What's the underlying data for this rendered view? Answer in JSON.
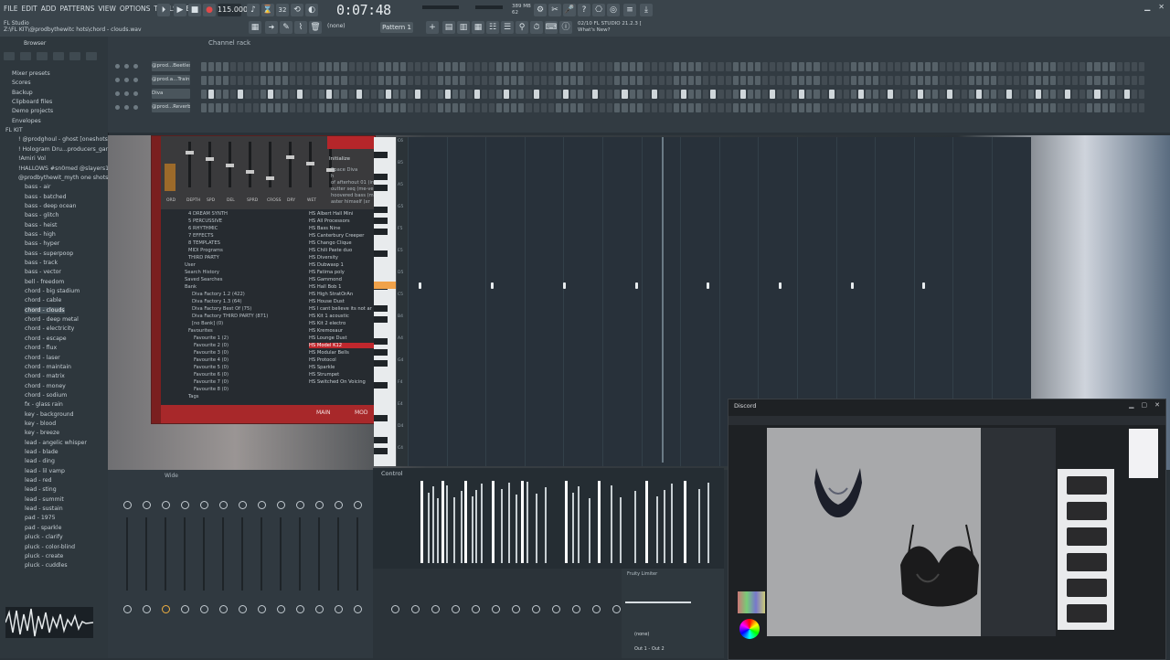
{
  "menu": [
    "FILE",
    "EDIT",
    "ADD",
    "PATTERNS",
    "VIEW",
    "OPTIONS",
    "TOOLS",
    "HELP"
  ],
  "file_info": {
    "line1": "FL Studio",
    "line2": "Z:\\FL KIT\\@prodbythewitc hots\\chord - clouds.wav"
  },
  "transport": {
    "tempo": "115.000",
    "time": "0:07:48",
    "pattern": "Pattern 1",
    "snap": "(none)"
  },
  "cpu": {
    "line1": "389 MB",
    "line2": "62"
  },
  "news": {
    "line1": "02/10  FL STUDIO 21.2.3 [",
    "line2": "What's New?"
  },
  "browser": {
    "title": "Browser",
    "items": [
      {
        "label": "Mixer presets",
        "indent": 1
      },
      {
        "label": "Scores",
        "indent": 1
      },
      {
        "label": "Backup",
        "indent": 1
      },
      {
        "label": "Clipboard files",
        "indent": 1
      },
      {
        "label": "Demo projects",
        "indent": 1
      },
      {
        "label": "Envelopes",
        "indent": 1
      },
      {
        "label": "FL KIT",
        "indent": 0
      },
      {
        "label": "! @prodghoul - ghost [oneshots]",
        "indent": 2
      },
      {
        "label": "! Hologram Dru...producers_gang]",
        "indent": 2
      },
      {
        "label": "!Amiri Vol",
        "indent": 2
      },
      {
        "label": "!HALLOWS #sn0med @slayers1de",
        "indent": 2
      },
      {
        "label": "@prodbythewit_myth one shots",
        "indent": 2
      },
      {
        "label": "bass - air",
        "indent": 3
      },
      {
        "label": "bass - batched",
        "indent": 3
      },
      {
        "label": "bass - deep ocean",
        "indent": 3
      },
      {
        "label": "bass - glitch",
        "indent": 3
      },
      {
        "label": "bass - heist",
        "indent": 3
      },
      {
        "label": "bass - high",
        "indent": 3
      },
      {
        "label": "bass - hyper",
        "indent": 3
      },
      {
        "label": "bass - superpoop",
        "indent": 3
      },
      {
        "label": "bass - track",
        "indent": 3
      },
      {
        "label": "bass - vector",
        "indent": 3
      },
      {
        "label": "bell - freedom",
        "indent": 3
      },
      {
        "label": "chord - big stadium",
        "indent": 3
      },
      {
        "label": "chord - cable",
        "indent": 3
      },
      {
        "label": "chord - clouds",
        "indent": 3
      },
      {
        "label": "chord - deep metal",
        "indent": 3
      },
      {
        "label": "chord - electricity",
        "indent": 3
      },
      {
        "label": "chord - escape",
        "indent": 3
      },
      {
        "label": "chord - flux",
        "indent": 3
      },
      {
        "label": "chord - laser",
        "indent": 3
      },
      {
        "label": "chord - maintain",
        "indent": 3
      },
      {
        "label": "chord - matrix",
        "indent": 3
      },
      {
        "label": "chord - money",
        "indent": 3
      },
      {
        "label": "chord - sodium",
        "indent": 3
      },
      {
        "label": "fx - glass rain",
        "indent": 3
      },
      {
        "label": "key - background",
        "indent": 3
      },
      {
        "label": "key - blood",
        "indent": 3
      },
      {
        "label": "key - breeze",
        "indent": 3
      },
      {
        "label": "lead - angelic whisper",
        "indent": 3
      },
      {
        "label": "lead - blade",
        "indent": 3
      },
      {
        "label": "lead - ding",
        "indent": 3
      },
      {
        "label": "lead - lil vamp",
        "indent": 3
      },
      {
        "label": "lead - red",
        "indent": 3
      },
      {
        "label": "lead - sting",
        "indent": 3
      },
      {
        "label": "lead - summit",
        "indent": 3
      },
      {
        "label": "lead - sustain",
        "indent": 3
      },
      {
        "label": "pad - 1975",
        "indent": 3
      },
      {
        "label": "pad - sparkle",
        "indent": 3
      },
      {
        "label": "pluck - clarify",
        "indent": 3
      },
      {
        "label": "pluck - color-blind",
        "indent": 3
      },
      {
        "label": "pluck - create",
        "indent": 3
      },
      {
        "label": "pluck - cuddles",
        "indent": 3
      }
    ]
  },
  "channel_rack": {
    "title": "Channel rack",
    "channels": [
      {
        "name": "@prod...Beetles"
      },
      {
        "name": "@prod.a...Train"
      },
      {
        "name": "Diva"
      },
      {
        "name": "@prod...Reverb"
      }
    ]
  },
  "plugin": {
    "knob_labels": [
      "ORD",
      "DEPTH",
      "SPD",
      "DEL",
      "SPRD",
      "CROSS",
      "DRY",
      "WET"
    ],
    "preset_header": "Initialize",
    "preset_lines": [
      "Space Diva",
      "h",
      "of afterhout 01 (in",
      "outter seq (me-ve",
      "hoovered bass (m",
      "aster himself (xr"
    ],
    "tree": [
      "4 DREAM SYNTH",
      "5 PERCUSSIVE",
      "6 RHYTHMIC",
      "7 EFFECTS",
      "8 TEMPLATES",
      "MIDI Programs",
      "THIRD PARTY",
      "User",
      "Search History",
      "Saved Searches",
      "Bank",
      "Diva Factory 1.2 (422)",
      "Diva Factory 1.3 (64)",
      "Diva Factory Best Of (75)",
      "Diva Factory THIRD PARTY (871)",
      "[no Bank] (0)",
      "Favourites",
      "Favourite 1 (2)",
      "Favourite 2 (0)",
      "Favourite 3 (0)",
      "Favourite 4 (0)",
      "Favourite 5 (0)",
      "Favourite 6 (0)",
      "Favourite 7 (0)",
      "Favourite 8 (0)",
      "Tags"
    ],
    "presets": [
      "HS Albert Hall Mini",
      "HS All Processors",
      "HS Bass Nine",
      "HS Canterbury Creeper",
      "HS Chango Clique",
      "HS Chili Paste duo",
      "HS Diversity",
      "HS Dubwasp 1",
      "HS Fatima poly",
      "HS Gammond",
      "HS Hall Bob 1",
      "HS High StratOrAn",
      "HS House Dust",
      "HS I cant believe its not ar",
      "HS Kit 1 acoustic",
      "HS Kit 2 electro",
      "HS Kremosaur",
      "HS Lounge Dust",
      "HS Model K12",
      "HS Modular Bells",
      "HS Protocol",
      "HS Sparkle",
      "HS Strumpet",
      "HS Switched On Voicing"
    ],
    "selected_preset": "HS Model K12",
    "footer_main": "MAIN",
    "footer_mod": "MOD"
  },
  "piano_roll": {
    "key_labels": [
      "C6",
      "B5",
      "A5",
      "G5",
      "F5",
      "E5",
      "D5",
      "C5",
      "B4",
      "A4",
      "G4",
      "F4",
      "E4",
      "D4",
      "C4"
    ]
  },
  "mixer": {
    "title": "Wide"
  },
  "control": {
    "label": "Control"
  },
  "fx": {
    "slot_label": "Fruity Limiter",
    "snap": "(none)",
    "output": "Out 1 - Out 2"
  },
  "discord": {
    "title": "Discord"
  }
}
